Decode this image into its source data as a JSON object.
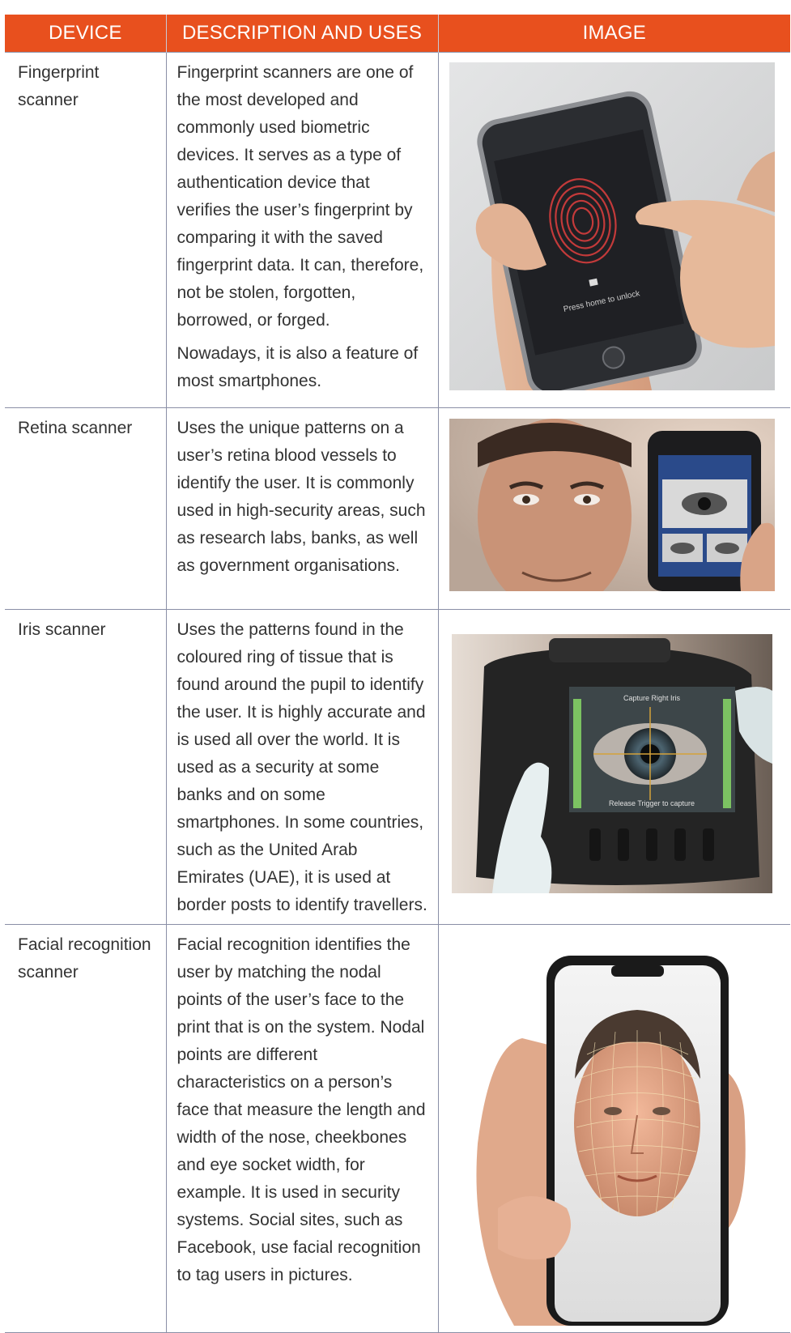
{
  "headers": {
    "device": "DEVICE",
    "description": "DESCRIPTION AND USES",
    "image": "IMAGE"
  },
  "colors": {
    "header_bg": "#e8501e",
    "header_text": "#ffffff",
    "border": "#8a8fa6",
    "body_text": "#333333"
  },
  "rows": [
    {
      "device": "Fingerprint scanner",
      "description": [
        "Fingerprint scanners are one of the most developed and commonly used biometric devices. It serves as a type of authentication device that verifies the user’s fingerprint by comparing it with the saved fingerprint data. It can, therefore, not be stolen, forgotten, borrowed, or forged.",
        "Nowadays, it is also a feature of most smartphones."
      ],
      "image": {
        "icon": "fingerprint-phone-photo",
        "screen_text": "Press home to unlock"
      }
    },
    {
      "device": "Retina scanner",
      "description": [
        "Uses the unique patterns on a user’s retina blood vessels to identify the user. It is commonly used in high-security areas, such as research labs, banks, as well as government organisations."
      ],
      "image": {
        "icon": "retina-scanner-photo"
      }
    },
    {
      "device": "Iris scanner",
      "description": [
        "Uses the patterns found in the coloured ring of tissue that is found around the pupil to identify the user. It is highly accurate and is used all over the world. It is used as a security at some banks and on some smartphones. In some countries, such as the United Arab Emirates (UAE), it is used at border posts to identify travellers."
      ],
      "image": {
        "icon": "iris-scanner-photo",
        "screen_text_top": "Capture Right Iris",
        "screen_text_bottom": "Release Trigger to capture"
      }
    },
    {
      "device": "Facial recognition scanner",
      "description": [
        "Facial recognition identifies the user by matching the nodal points of the user’s face to the print that is on the system. Nodal points are different characteristics on a person’s face that measure the length and width of the nose, cheekbones and eye socket width, for example. It is used in security systems. Social sites, such as Facebook, use facial recognition to tag users in pictures."
      ],
      "image": {
        "icon": "facial-recognition-phone-photo"
      }
    }
  ]
}
